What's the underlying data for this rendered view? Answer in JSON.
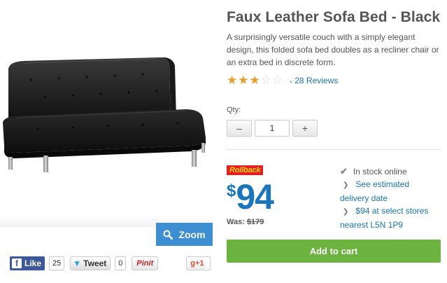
{
  "product": {
    "title": "Faux Leather Sofa Bed - Black",
    "description": "A surprisingly versatile couch with a simply elegant design, this folded sofa bed doubles as a recliner chair or an extra bed in discrete form.",
    "rating": 3,
    "rating_max": 5,
    "reviews_label": "28 Reviews"
  },
  "image": {
    "zoom_label": "Zoom"
  },
  "quantity": {
    "label": "Qty:",
    "value": "1",
    "minus": "–",
    "plus": "+"
  },
  "pricing": {
    "badge": "Rollback",
    "currency": "$",
    "amount": "94",
    "was_label": "Was:",
    "was_price": "$179"
  },
  "availability": {
    "in_stock": "In stock online",
    "delivery_link": "See estimated",
    "delivery_link_2": "delivery date",
    "store_link": "$94 at select stores",
    "store_link_2": "nearest L5N 1P9"
  },
  "cart": {
    "add_label": "Add to cart"
  },
  "social": {
    "like_label": "Like",
    "like_count": "25",
    "tweet_label": "Tweet",
    "tweet_count": "0",
    "pin_label": "Pinit",
    "gplus_label": "g+1"
  },
  "colors": {
    "accent": "#1a75ba",
    "zoom": "#3d8fd1",
    "cart": "#6cb33f",
    "rollback": "#e31f26",
    "star": "#e99c26"
  }
}
